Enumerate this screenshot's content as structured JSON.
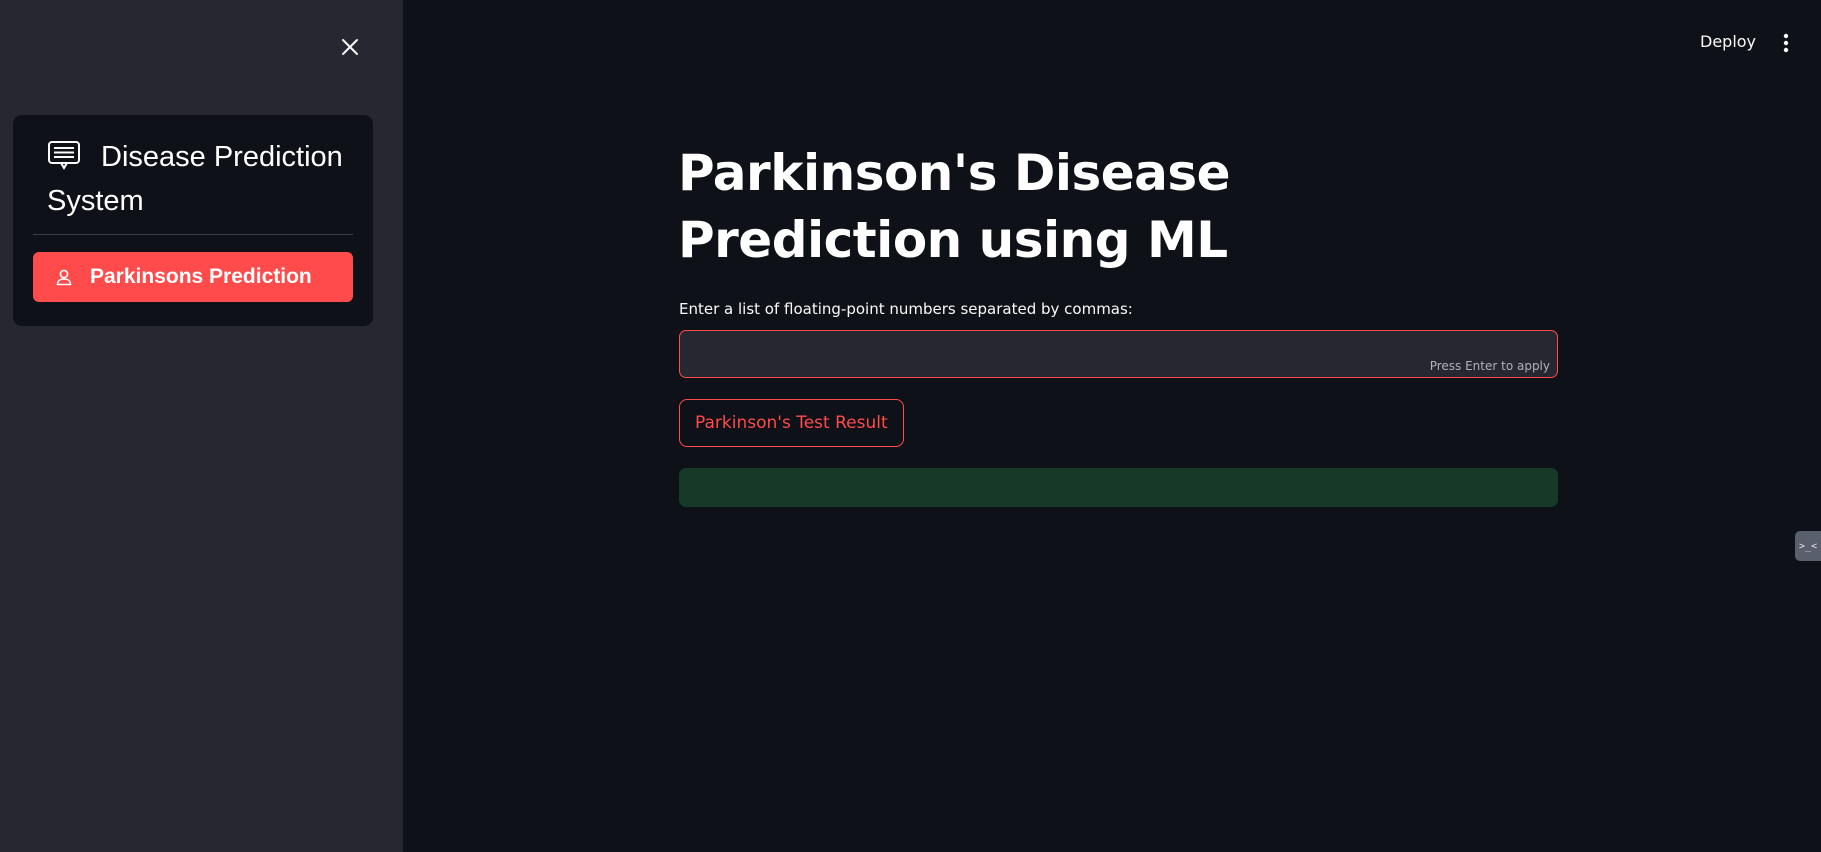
{
  "sidebar": {
    "close_icon": "close-icon",
    "menu": {
      "title": "Disease Prediction System",
      "title_icon": "chat-text-icon",
      "items": [
        {
          "label": "Parkinsons Prediction",
          "icon": "person-icon",
          "selected": true
        }
      ]
    }
  },
  "header": {
    "deploy_label": "Deploy",
    "menu_icon": "kebab-menu-icon"
  },
  "main": {
    "title": "Parkinson's Disease Prediction using ML",
    "input": {
      "label": "Enter a list of floating-point numbers separated by commas:",
      "value": "",
      "hint": "Press Enter to apply"
    },
    "result_button_label": "Parkinson's Test Result",
    "result_message": ""
  },
  "colors": {
    "accent": "#ff4b4b",
    "background": "#0e1117",
    "sidebar_background": "#262730",
    "success_background": "#173928"
  }
}
